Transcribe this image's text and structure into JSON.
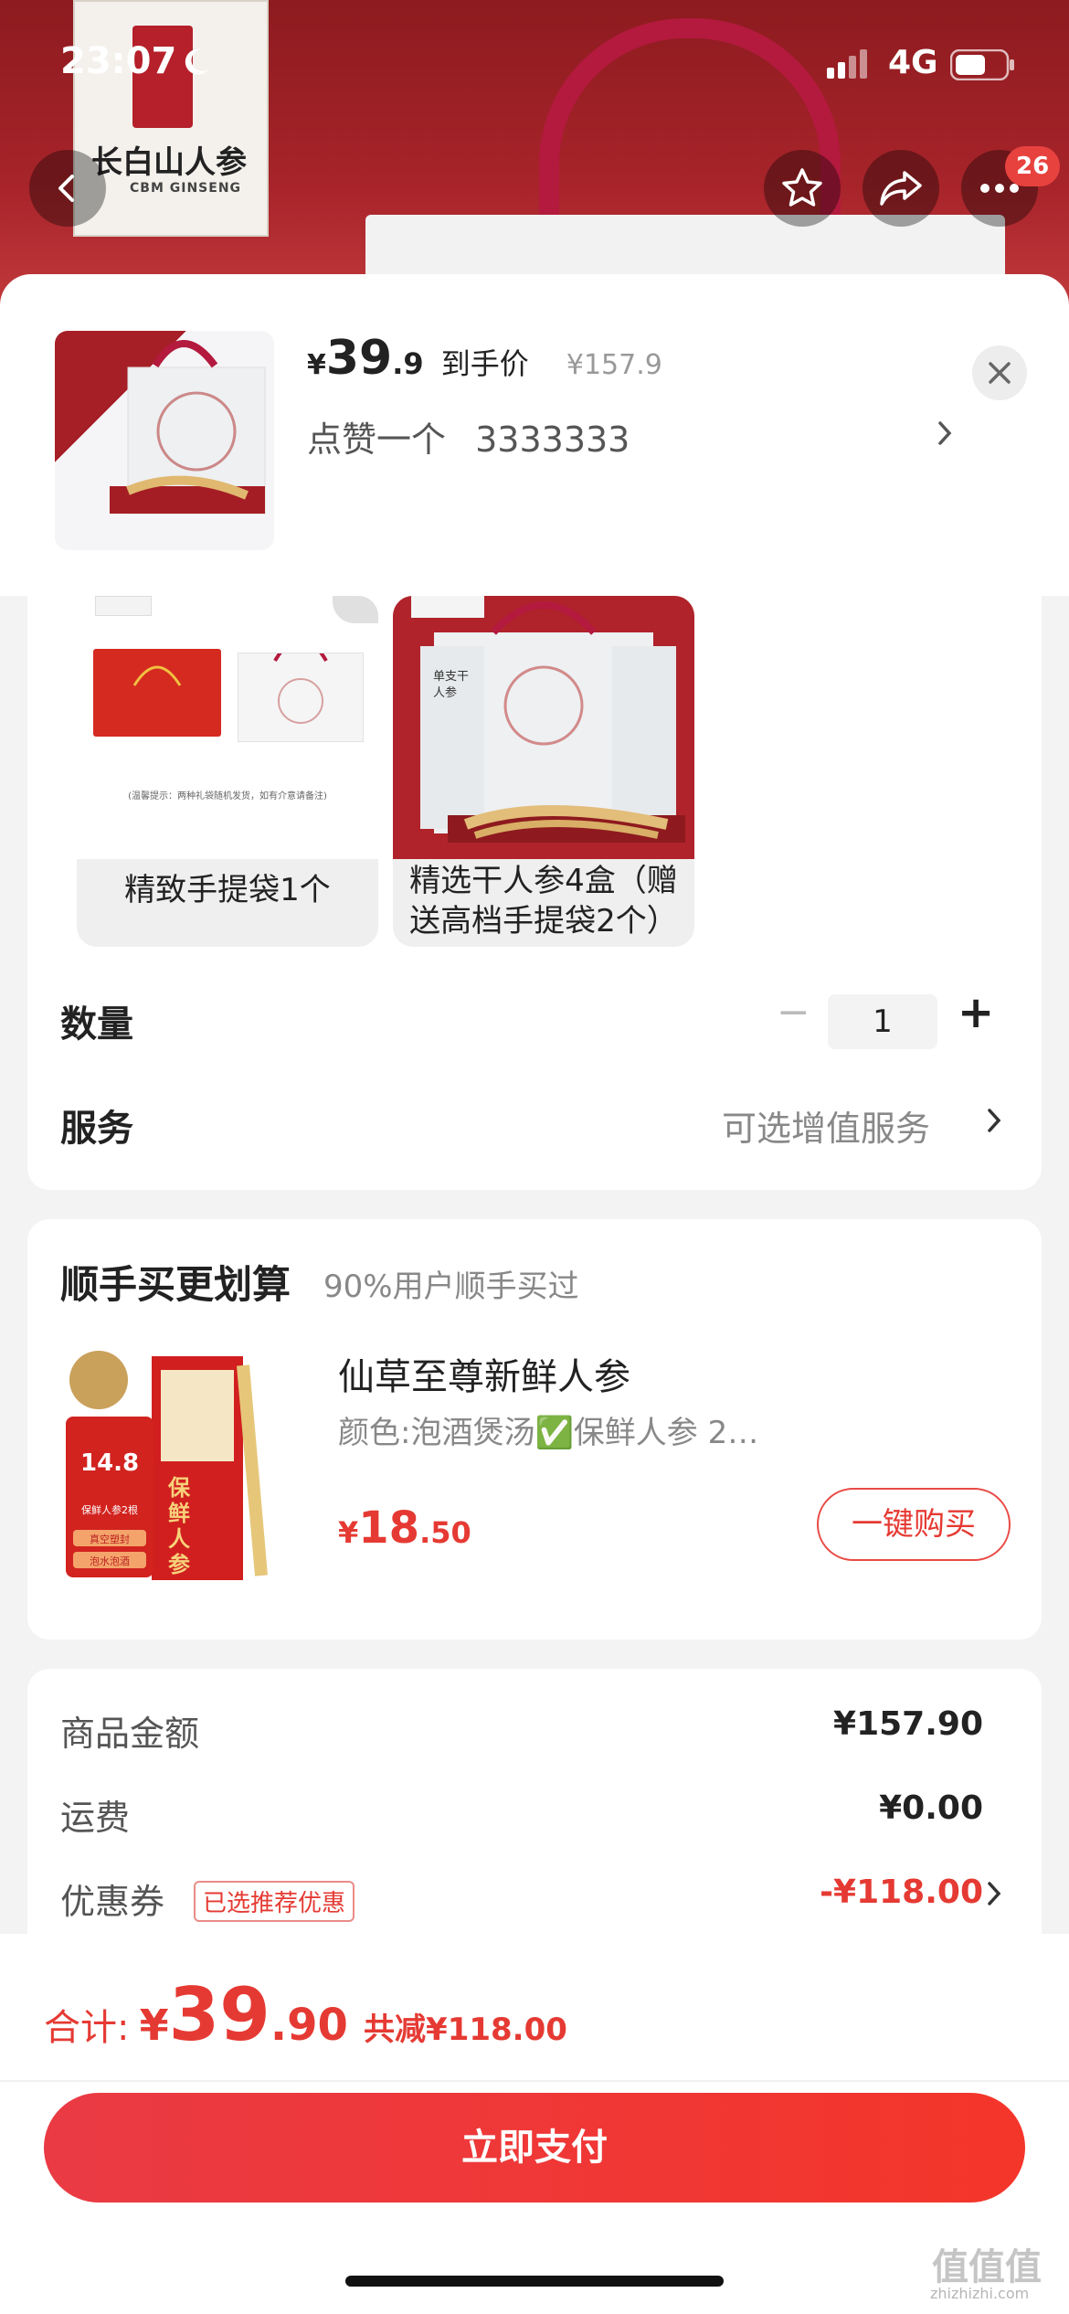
{
  "status_bar": {
    "time": "23:07",
    "network": "4G"
  },
  "hero": {
    "brand_cn": "长白山人参",
    "brand_en": "CBM GINSENG",
    "cart_count": "26"
  },
  "header": {
    "price_symbol": "¥",
    "price_int": "39",
    "price_dec": ".9",
    "price_label": "到手价",
    "original_price": "¥157.9",
    "promo_label": "点赞一个",
    "promo_value": "3333333"
  },
  "variants": [
    {
      "label": "精致手提袋1个",
      "note": "(温馨提示：两种礼袋随机发货，如有介意请备注)"
    },
    {
      "label": "精选干人参4盒（赠送高档手提袋2个）",
      "box_text": "单支干人参"
    }
  ],
  "quantity": {
    "label": "数量",
    "value": "1",
    "minus": "−",
    "plus": "+"
  },
  "service": {
    "label": "服务",
    "value": "可选增值服务"
  },
  "recommend": {
    "title": "顺手买更划算",
    "subtitle": "90%用户顺手买过",
    "product_name": "仙草至尊新鲜人参",
    "product_spec": "颜色:泡酒煲汤✅保鲜人参 2…",
    "price_symbol": "¥",
    "price_int": "18",
    "price_dec": ".50",
    "buy_label": "一键购买",
    "img_price": "14.8",
    "img_tags": [
      "保鲜人参2根",
      "真空塑封",
      "泡水泡酒"
    ],
    "img_title": "保鲜人参"
  },
  "summary": {
    "rows": [
      {
        "label": "商品金额",
        "value": "¥157.90"
      },
      {
        "label": "运费",
        "value": "¥0.00"
      },
      {
        "label": "优惠券",
        "tag": "已选推荐优惠",
        "value": "-¥118.00"
      }
    ]
  },
  "bottom": {
    "total_label": "合计:",
    "total_symbol": "¥",
    "total_int": "39",
    "total_dec": ".90",
    "saved": "共减¥118.00",
    "pay_label": "立即支付"
  },
  "watermark": {
    "text": "值值值",
    "sub": "zhizhizhi.com"
  },
  "colors": {
    "accent": "#e53a33",
    "pay_button": "#f0383a",
    "hero_red": "#a7242a"
  }
}
